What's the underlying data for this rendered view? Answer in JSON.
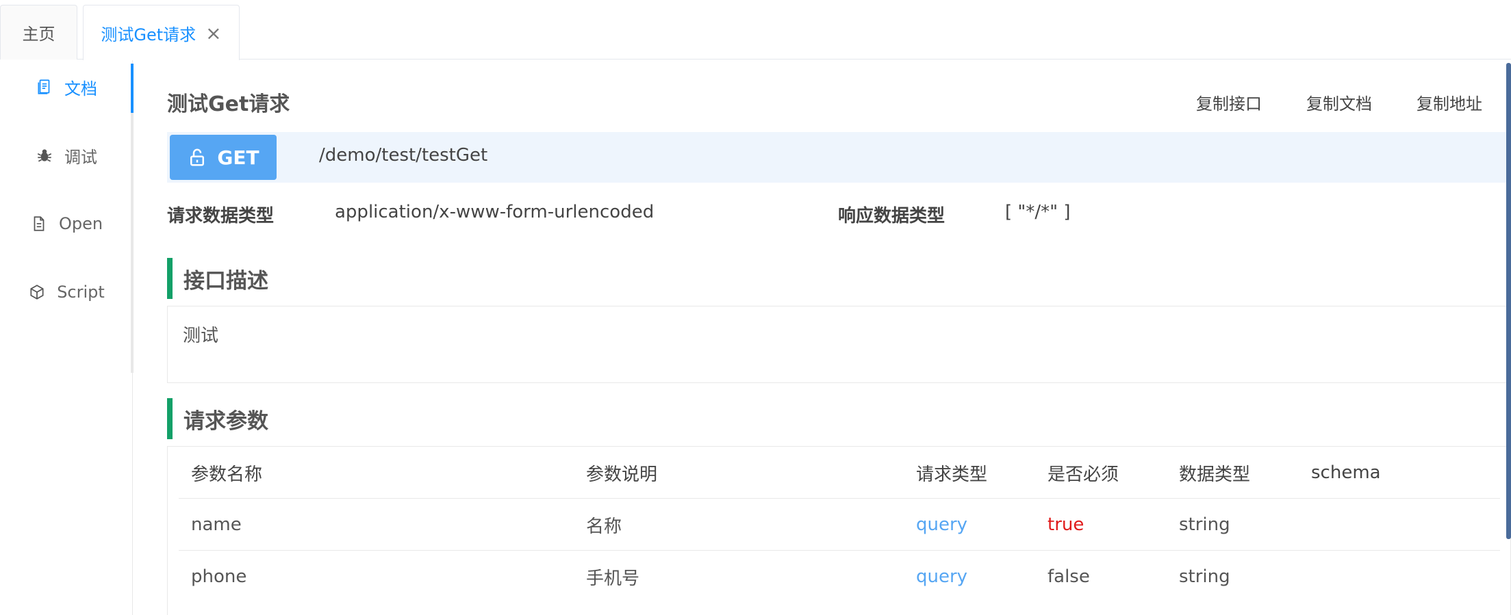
{
  "tabs": {
    "home": "主页",
    "active": "测试Get请求",
    "close_symbol": "×"
  },
  "nav": {
    "items": [
      {
        "label": "文档",
        "icon": "document-icon",
        "active": true
      },
      {
        "label": "调试",
        "icon": "bug-icon",
        "active": false
      },
      {
        "label": "Open",
        "icon": "file-icon",
        "active": false
      },
      {
        "label": "Script",
        "icon": "code-sandbox-icon",
        "active": false
      }
    ]
  },
  "header": {
    "title": "测试Get请求",
    "actions": [
      "复制接口",
      "复制文档",
      "复制地址"
    ]
  },
  "request": {
    "method": "GET",
    "path": "/demo/test/testGet",
    "method_color": "#56a6f3",
    "request_type_label": "请求数据类型",
    "request_type_value": "application/x-www-form-urlencoded",
    "response_type_label": "响应数据类型",
    "response_type_value": "[ \"*/*\" ]"
  },
  "description": {
    "heading": "接口描述",
    "text": "测试"
  },
  "params": {
    "heading": "请求参数",
    "columns": [
      "参数名称",
      "参数说明",
      "请求类型",
      "是否必须",
      "数据类型",
      "schema"
    ],
    "rows": [
      [
        "name",
        "名称",
        "query",
        "true",
        "string",
        ""
      ],
      [
        "phone",
        "手机号",
        "query",
        "false",
        "string",
        ""
      ]
    ]
  },
  "colors": {
    "accent": "#1890ff",
    "section_bar": "#13a068",
    "required_true": "#e01b1b"
  }
}
